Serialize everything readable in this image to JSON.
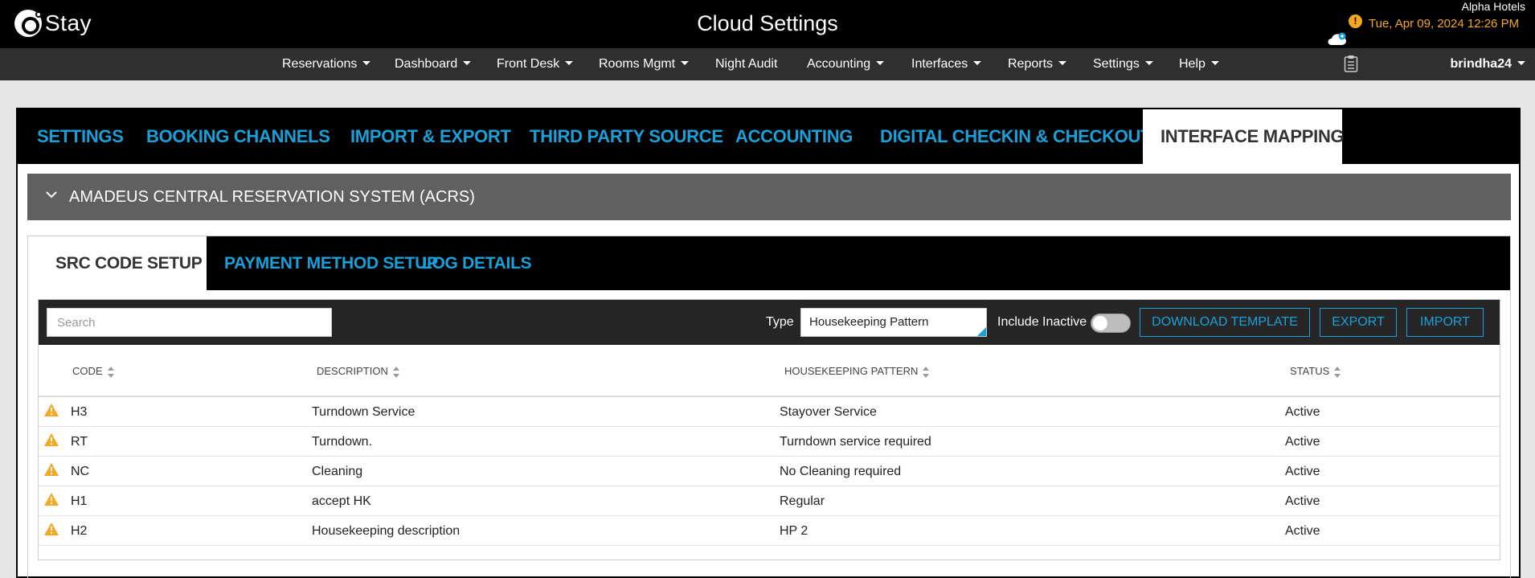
{
  "header": {
    "logo_text": "Stay",
    "title": "Cloud Settings",
    "hotel": "Alpha Hotels",
    "datetime": "Tue, Apr 09, 2024 12:26 PM",
    "alert_glyph": "!"
  },
  "nav": {
    "items": [
      {
        "label": "Reservations",
        "dropdown": true
      },
      {
        "label": "Dashboard",
        "dropdown": true
      },
      {
        "label": "Front Desk",
        "dropdown": true
      },
      {
        "label": "Rooms Mgmt",
        "dropdown": true
      },
      {
        "label": "Night Audit",
        "dropdown": false
      },
      {
        "label": "Accounting",
        "dropdown": true
      },
      {
        "label": "Interfaces",
        "dropdown": true
      },
      {
        "label": "Reports",
        "dropdown": true
      },
      {
        "label": "Settings",
        "dropdown": true
      },
      {
        "label": "Help",
        "dropdown": true
      }
    ],
    "user": "brindha24"
  },
  "main_tabs": [
    {
      "label": "SETTINGS",
      "active": false
    },
    {
      "label": "BOOKING CHANNELS",
      "active": false
    },
    {
      "label": "IMPORT & EXPORT",
      "active": false
    },
    {
      "label": "THIRD PARTY SOURCE",
      "active": false
    },
    {
      "label": "ACCOUNTING",
      "active": false
    },
    {
      "label": "DIGITAL CHECKIN & CHECKOUT",
      "active": false
    },
    {
      "label": "INTERFACE MAPPING",
      "active": true
    }
  ],
  "accordion": {
    "title": "AMADEUS CENTRAL RESERVATION SYSTEM (ACRS)"
  },
  "sub_tabs": [
    {
      "label": "SRC CODE SETUP",
      "active": true
    },
    {
      "label": "PAYMENT METHOD SETUP",
      "active": false
    },
    {
      "label": "LOG DETAILS",
      "active": false
    }
  ],
  "toolbar": {
    "search_placeholder": "Search",
    "type_label": "Type",
    "type_value": "Housekeeping Pattern",
    "include_inactive_label": "Include Inactive",
    "include_inactive": false,
    "download_label": "DOWNLOAD TEMPLATE",
    "export_label": "EXPORT",
    "import_label": "IMPORT"
  },
  "table": {
    "columns": [
      "CODE",
      "DESCRIPTION",
      "HOUSEKEEPING PATTERN",
      "STATUS"
    ],
    "rows": [
      {
        "code": "H3",
        "description": "Turndown Service",
        "pattern": "Stayover Service",
        "status": "Active"
      },
      {
        "code": "RT",
        "description": "Turndown.",
        "pattern": "Turndown service required",
        "status": "Active"
      },
      {
        "code": "NC",
        "description": "Cleaning",
        "pattern": "No Cleaning required",
        "status": "Active"
      },
      {
        "code": "H1",
        "description": "accept HK",
        "pattern": "Regular",
        "status": "Active"
      },
      {
        "code": "H2",
        "description": "Housekeeping description",
        "pattern": "HP 2",
        "status": "Active"
      }
    ]
  },
  "colors": {
    "accent": "#1aa0d8",
    "warning": "#f5a623",
    "topbar": "#000000",
    "navbar": "#2f2f2f"
  }
}
